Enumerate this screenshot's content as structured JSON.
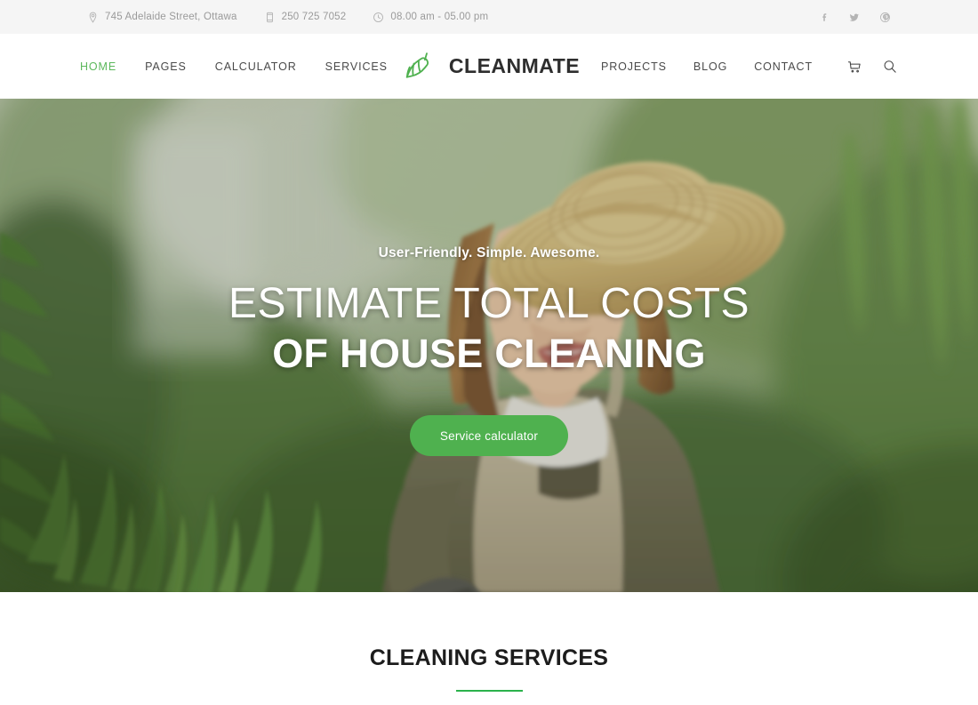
{
  "topbar": {
    "address": "745 Adelaide Street, Ottawa",
    "phone": "250 725 7052",
    "hours": "08.00 am - 05.00 pm",
    "icons": {
      "address": "location-pin-icon",
      "phone": "mobile-phone-icon",
      "hours": "clock-icon"
    },
    "social": [
      {
        "name": "facebook",
        "label": "f"
      },
      {
        "name": "twitter",
        "label": "t"
      },
      {
        "name": "pinterest",
        "label": "p"
      }
    ]
  },
  "header": {
    "logo_text": "CLEANMATE",
    "logo_icon": "broom-icon",
    "nav_left": [
      {
        "label": "HOME",
        "active": true
      },
      {
        "label": "PAGES",
        "active": false
      },
      {
        "label": "CALCULATOR",
        "active": false
      },
      {
        "label": "SERVICES",
        "active": false
      }
    ],
    "nav_right": [
      {
        "label": "PROJECTS",
        "active": false
      },
      {
        "label": "BLOG",
        "active": false
      },
      {
        "label": "CONTACT",
        "active": false
      }
    ],
    "cart_icon": "shopping-cart-icon",
    "search_icon": "search-icon"
  },
  "hero": {
    "subtitle": "User-Friendly. Simple. Awesome.",
    "title_line1": "ESTIMATE TOTAL COSTS",
    "title_line2": "OF HOUSE CLEANING",
    "cta_label": "Service calculator"
  },
  "services": {
    "title": "CLEANING SERVICES"
  },
  "colors": {
    "accent_green": "#4fb14f",
    "rule_green": "#2bb24c",
    "nav_active": "#5cb85c",
    "topbar_bg": "#f5f5f5",
    "text_dark": "#2e2e2e"
  }
}
